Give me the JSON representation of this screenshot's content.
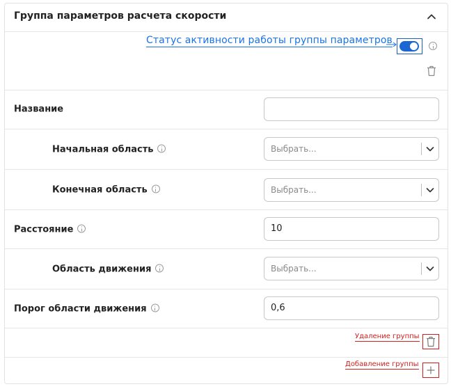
{
  "header": {
    "title": "Группа параметров расчета скорости"
  },
  "status": {
    "callout": "Статус активности работы группы параметров",
    "active": true
  },
  "form": {
    "name_label": "Название",
    "name_value": "",
    "start_area_label": "Начальная область",
    "start_area_placeholder": "Выбрать...",
    "end_area_label": "Конечная область",
    "end_area_placeholder": "Выбрать...",
    "distance_label": "Расстояние",
    "distance_value": "10",
    "motion_area_label": "Область движения",
    "motion_area_placeholder": "Выбрать...",
    "motion_threshold_label": "Порог области движения",
    "motion_threshold_value": "0,6"
  },
  "annotations": {
    "delete_group": "Удаление группы",
    "add_group": "Добавление группы"
  },
  "colors": {
    "accent": "#1a66d2",
    "callout_blue": "#1a73e8",
    "callout_red": "#d01d1d",
    "border": "#c7c7c7"
  },
  "icons": [
    "chevron-up-icon",
    "info-icon",
    "trash-icon",
    "chevron-down-icon",
    "plus-icon"
  ]
}
